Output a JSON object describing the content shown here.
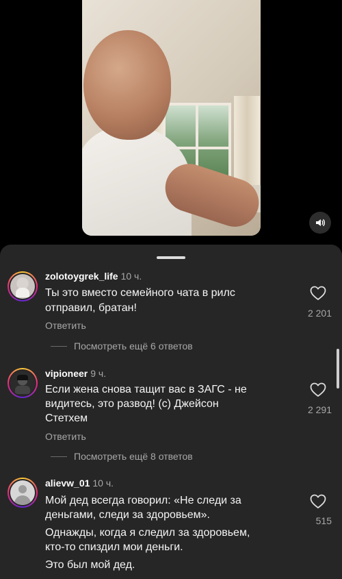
{
  "video": {
    "sound_icon": "speaker-icon"
  },
  "comments": [
    {
      "username": "zolotoygrek_life",
      "time": "10 ч.",
      "lines": [
        "Ты это вместо семейного чата в рилс",
        "отправил, братан!"
      ],
      "reply_label": "Ответить",
      "more_replies": "Посмотреть ещё 6 ответов",
      "likes": "2 201"
    },
    {
      "username": "vipioneer",
      "time": "9 ч.",
      "lines": [
        "Если жена снова тащит вас в ЗАГС - не",
        "видитесь, это развод! (с) Джейсон",
        "Стетхем"
      ],
      "reply_label": "Ответить",
      "more_replies": "Посмотреть ещё 8 ответов",
      "likes": "2 291"
    },
    {
      "username": "alievw_01",
      "time": "10 ч.",
      "lines": [
        "Мой дед всегда говорил: «Не следи за",
        "деньгами, следи за здоровьем».",
        "Однажды, когда я следил за здоровьем,",
        "кто-то спиздил мои деньги.",
        "Это был мой дед."
      ],
      "likes": "515"
    }
  ],
  "colors": {
    "sheet_bg": "#262626",
    "secondary_text": "#a8a8a8",
    "primary_text": "#f5f5f5"
  }
}
